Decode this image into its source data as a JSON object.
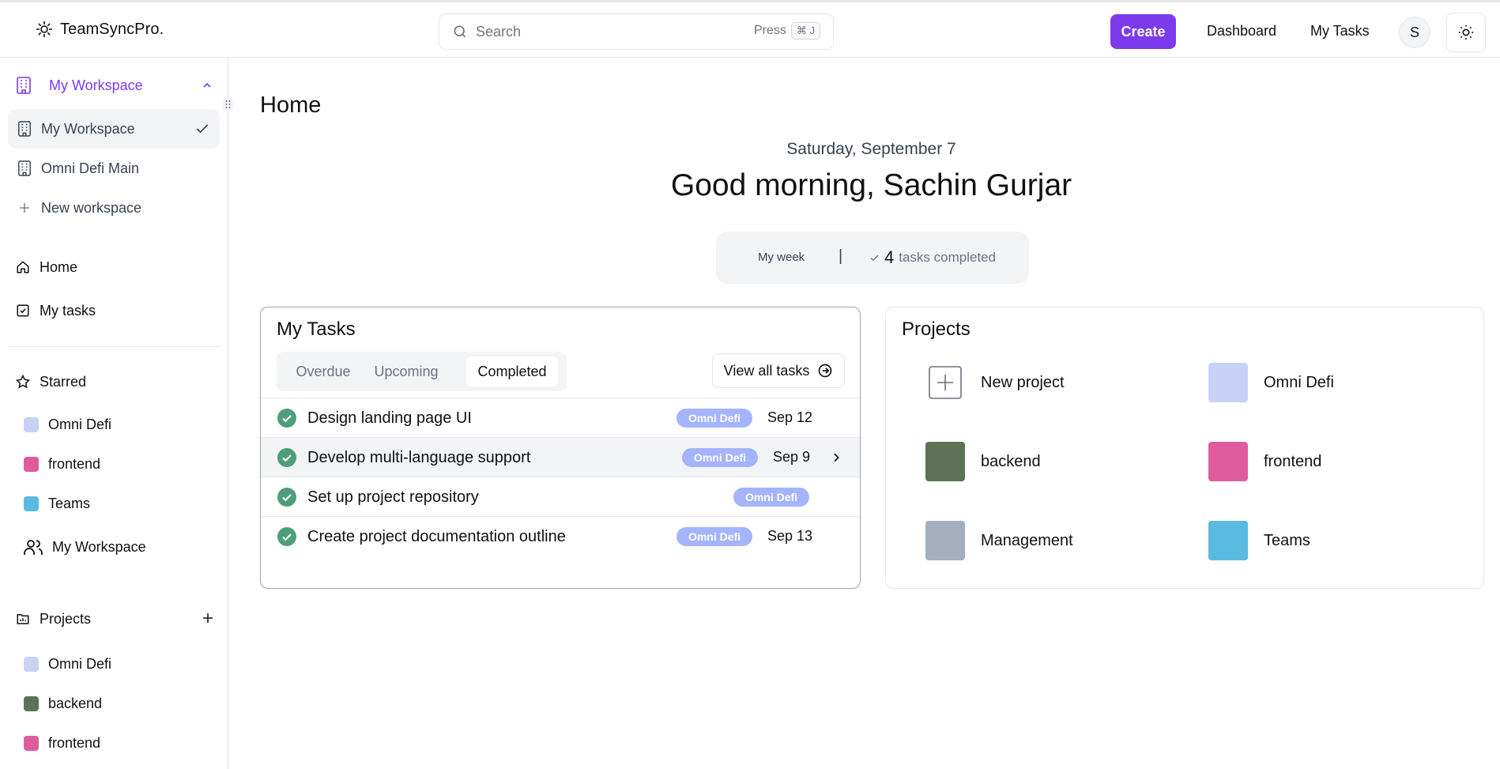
{
  "app": {
    "name": "TeamSyncPro."
  },
  "search": {
    "placeholder": "Search",
    "hint": "Press",
    "shortcut": "⌘ J"
  },
  "header": {
    "create_label": "Create",
    "dashboard_label": "Dashboard",
    "my_tasks_label": "My Tasks",
    "avatar_initial": "S"
  },
  "sidebar": {
    "workspace_header": "My Workspace",
    "workspaces": [
      {
        "label": "My Workspace",
        "selected": true
      },
      {
        "label": "Omni Defi Main",
        "selected": false
      }
    ],
    "new_workspace_label": "New workspace",
    "nav": [
      {
        "label": "Home",
        "icon": "home-icon"
      },
      {
        "label": "My tasks",
        "icon": "check-square-icon"
      }
    ],
    "starred_label": "Starred",
    "starred": [
      {
        "label": "Omni Defi",
        "color": "#c7d2f5"
      },
      {
        "label": "frontend",
        "color": "#de5c9d"
      },
      {
        "label": "Teams",
        "color": "#5bbae0"
      }
    ],
    "starred_team": "My Workspace",
    "projects_label": "Projects",
    "projects": [
      {
        "label": "Omni Defi",
        "color": "#c7d2f5"
      },
      {
        "label": "backend",
        "color": "#5d7256"
      },
      {
        "label": "frontend",
        "color": "#de5c9d"
      }
    ]
  },
  "main": {
    "title": "Home",
    "date": "Saturday, September 7",
    "greeting": "Good morning, Sachin Gurjar",
    "week": {
      "label": "My week",
      "separator": "|",
      "count": "4",
      "suffix": "tasks completed"
    }
  },
  "tasks": {
    "title": "My Tasks",
    "tabs": [
      {
        "label": "Overdue",
        "active": false
      },
      {
        "label": "Upcoming",
        "active": false
      },
      {
        "label": "Completed",
        "active": true
      }
    ],
    "view_all_label": "View all tasks",
    "items": [
      {
        "title": "Design landing page UI",
        "project": "Omni Defi",
        "due": "Sep 12"
      },
      {
        "title": "Develop multi-language support",
        "project": "Omni Defi",
        "due": "Sep 9"
      },
      {
        "title": "Set up project repository",
        "project": "Omni Defi",
        "due": ""
      },
      {
        "title": "Create project documentation outline",
        "project": "Omni Defi",
        "due": "Sep 13"
      }
    ]
  },
  "projects": {
    "title": "Projects",
    "new_label": "New project",
    "items": [
      {
        "label": "Omni Defi",
        "color": "#c7d2f5"
      },
      {
        "label": "backend",
        "color": "#5d7256"
      },
      {
        "label": "frontend",
        "color": "#de5c9d"
      },
      {
        "label": "Management",
        "color": "#a3afbe"
      },
      {
        "label": "Teams",
        "color": "#5bbae0"
      }
    ]
  },
  "colors": {
    "accent": "#7c3aed",
    "badge": "#a5b4fc",
    "success": "#4e9e7c"
  }
}
